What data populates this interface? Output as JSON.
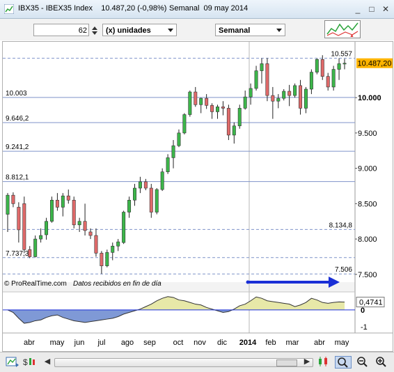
{
  "window": {
    "title": "IBX35 - IBEX35 Index    10.487,20 (-0,98%)",
    "period_date": "Semanal  09 may 2014",
    "minimize_label": "_",
    "maximize_label": "□",
    "close_label": "✕"
  },
  "toolbar": {
    "units_value": "62",
    "units_type": "(x) unidades",
    "timeframe": "Semanal"
  },
  "chart": {
    "last_price_badge": "10.487,20",
    "watermark": "© ProRealTime.com",
    "data_note": "Datos recibidos en fin de día",
    "oscillator_value": "0,4741",
    "price_levels": [
      {
        "value": 10557,
        "label": "10.557",
        "style": "dashed"
      },
      {
        "value": 10003,
        "label": "10.003",
        "style": "solid"
      },
      {
        "value": 9646.2,
        "label": "9.646,2",
        "style": "solid"
      },
      {
        "value": 9241.2,
        "label": "9.241,2",
        "style": "solid"
      },
      {
        "value": 8812.1,
        "label": "8.812,1",
        "style": "solid"
      },
      {
        "value": 8134.8,
        "label": "8.134,8",
        "style": "dashed"
      },
      {
        "value": 7737.3,
        "label": "7.737,3",
        "style": "dashed"
      },
      {
        "value": 7506,
        "label": "7.506",
        "style": "dashed"
      }
    ],
    "y_ticks": [
      {
        "value": 10000,
        "label": "10.000"
      },
      {
        "value": 9500,
        "label": "9.500"
      },
      {
        "value": 9000,
        "label": "9.000"
      },
      {
        "value": 8500,
        "label": "8.500"
      },
      {
        "value": 8000,
        "label": "8.000"
      },
      {
        "value": 7500,
        "label": "7.500"
      }
    ],
    "osc_ticks": [
      "0",
      "-1"
    ],
    "x_labels": [
      "abr",
      "may",
      "jun",
      "jul",
      "ago",
      "sep",
      "oct",
      "nov",
      "dic",
      "2014",
      "feb",
      "mar",
      "abr",
      "may"
    ],
    "colors": {
      "up": "#3cb64a",
      "down": "#e06a6a",
      "grid": "#7f93c9",
      "osc_fill": "#e7e8a8",
      "osc_neg_fill": "#7f99d6",
      "arrow": "#1a2fd6"
    }
  },
  "chart_data": {
    "type": "candlestick",
    "ylim": [
      7390,
      10770
    ],
    "x": [
      "abr",
      "may",
      "jun",
      "jul",
      "ago",
      "sep",
      "oct",
      "nov",
      "dic",
      "2014",
      "feb",
      "mar",
      "abr",
      "may"
    ],
    "candles": [
      [
        8350,
        8650,
        8100,
        8620
      ],
      [
        8620,
        8660,
        8450,
        8500
      ],
      [
        8450,
        8520,
        7950,
        8130
      ],
      [
        8500,
        8600,
        7800,
        7850
      ],
      [
        7850,
        7900,
        7730,
        7750
      ],
      [
        7750,
        8050,
        7740,
        8000
      ],
      [
        8000,
        8150,
        7950,
        8050
      ],
      [
        8060,
        8300,
        7990,
        8250
      ],
      [
        8250,
        8600,
        8230,
        8550
      ],
      [
        8550,
        8650,
        8400,
        8450
      ],
      [
        8450,
        8650,
        8320,
        8610
      ],
      [
        8610,
        8700,
        8500,
        8550
      ],
      [
        8550,
        8600,
        8150,
        8200
      ],
      [
        8200,
        8300,
        8100,
        8250
      ],
      [
        8250,
        8500,
        8050,
        8120
      ],
      [
        8100,
        8150,
        8000,
        8050
      ],
      [
        8050,
        8150,
        7750,
        7800
      ],
      [
        7800,
        7830,
        7506,
        7620
      ],
      [
        7620,
        7850,
        7600,
        7810
      ],
      [
        7810,
        7950,
        7700,
        7900
      ],
      [
        7900,
        8000,
        7830,
        7960
      ],
      [
        7950,
        8400,
        7930,
        8380
      ],
      [
        8380,
        8600,
        8300,
        8550
      ],
      [
        8550,
        8780,
        8470,
        8720
      ],
      [
        8720,
        8880,
        8650,
        8810
      ],
      [
        8810,
        8850,
        8690,
        8720
      ],
      [
        8720,
        8780,
        8300,
        8380
      ],
      [
        8380,
        8720,
        8350,
        8700
      ],
      [
        8700,
        9000,
        8680,
        8950
      ],
      [
        8950,
        9200,
        8920,
        9150
      ],
      [
        9150,
        9400,
        9000,
        9320
      ],
      [
        9320,
        9550,
        9300,
        9500
      ],
      [
        9500,
        9780,
        9480,
        9760
      ],
      [
        9760,
        10100,
        9730,
        10080
      ],
      [
        10080,
        10150,
        9870,
        9900
      ],
      [
        9900,
        10000,
        9780,
        9990
      ],
      [
        9990,
        10050,
        9840,
        9890
      ],
      [
        9890,
        9920,
        9700,
        9800
      ],
      [
        9800,
        9900,
        9700,
        9870
      ],
      [
        9870,
        9950,
        9750,
        9850
      ],
      [
        9850,
        9900,
        9400,
        9470
      ],
      [
        9470,
        9650,
        9350,
        9600
      ],
      [
        9600,
        9900,
        9560,
        9850
      ],
      [
        9850,
        10100,
        9830,
        10010
      ],
      [
        10010,
        10200,
        9900,
        10130
      ],
      [
        10130,
        10450,
        10100,
        10380
      ],
      [
        10380,
        10557,
        10200,
        10480
      ],
      [
        10480,
        10560,
        9950,
        10030
      ],
      [
        10030,
        10150,
        9700,
        9950
      ],
      [
        9950,
        10050,
        9850,
        9990
      ],
      [
        9990,
        10120,
        9960,
        10090
      ],
      [
        10090,
        10180,
        9880,
        10030
      ],
      [
        10030,
        10200,
        10000,
        10170
      ],
      [
        10170,
        10250,
        9760,
        9850
      ],
      [
        9850,
        10150,
        9780,
        10120
      ],
      [
        10120,
        10400,
        10050,
        10360
      ],
      [
        10360,
        10557,
        10330,
        10540
      ],
      [
        10540,
        10600,
        10250,
        10300
      ],
      [
        10300,
        10350,
        10100,
        10150
      ],
      [
        10150,
        10450,
        10100,
        10400
      ],
      [
        10400,
        10557,
        10250,
        10480
      ],
      [
        10480,
        10550,
        10400,
        10487
      ]
    ],
    "oscillator": [
      0.0,
      -0.15,
      -0.5,
      -0.8,
      -0.75,
      -0.65,
      -0.6,
      -0.45,
      -0.35,
      -0.3,
      -0.45,
      -0.55,
      -0.65,
      -0.7,
      -0.75,
      -0.7,
      -0.65,
      -0.6,
      -0.55,
      -0.5,
      -0.4,
      -0.25,
      -0.15,
      -0.05,
      0.05,
      0.2,
      0.35,
      0.55,
      0.7,
      0.8,
      0.75,
      0.6,
      0.55,
      0.45,
      0.35,
      0.3,
      0.15,
      0.05,
      -0.05,
      -0.15,
      -0.1,
      0.05,
      0.25,
      0.35,
      0.55,
      0.78,
      0.7,
      0.55,
      0.5,
      0.45,
      0.4,
      0.35,
      0.2,
      0.3,
      0.45,
      0.7,
      0.6,
      0.45,
      0.4,
      0.45,
      0.48,
      0.4741
    ],
    "oscillator_ylim": [
      -1.3,
      1.0
    ]
  }
}
